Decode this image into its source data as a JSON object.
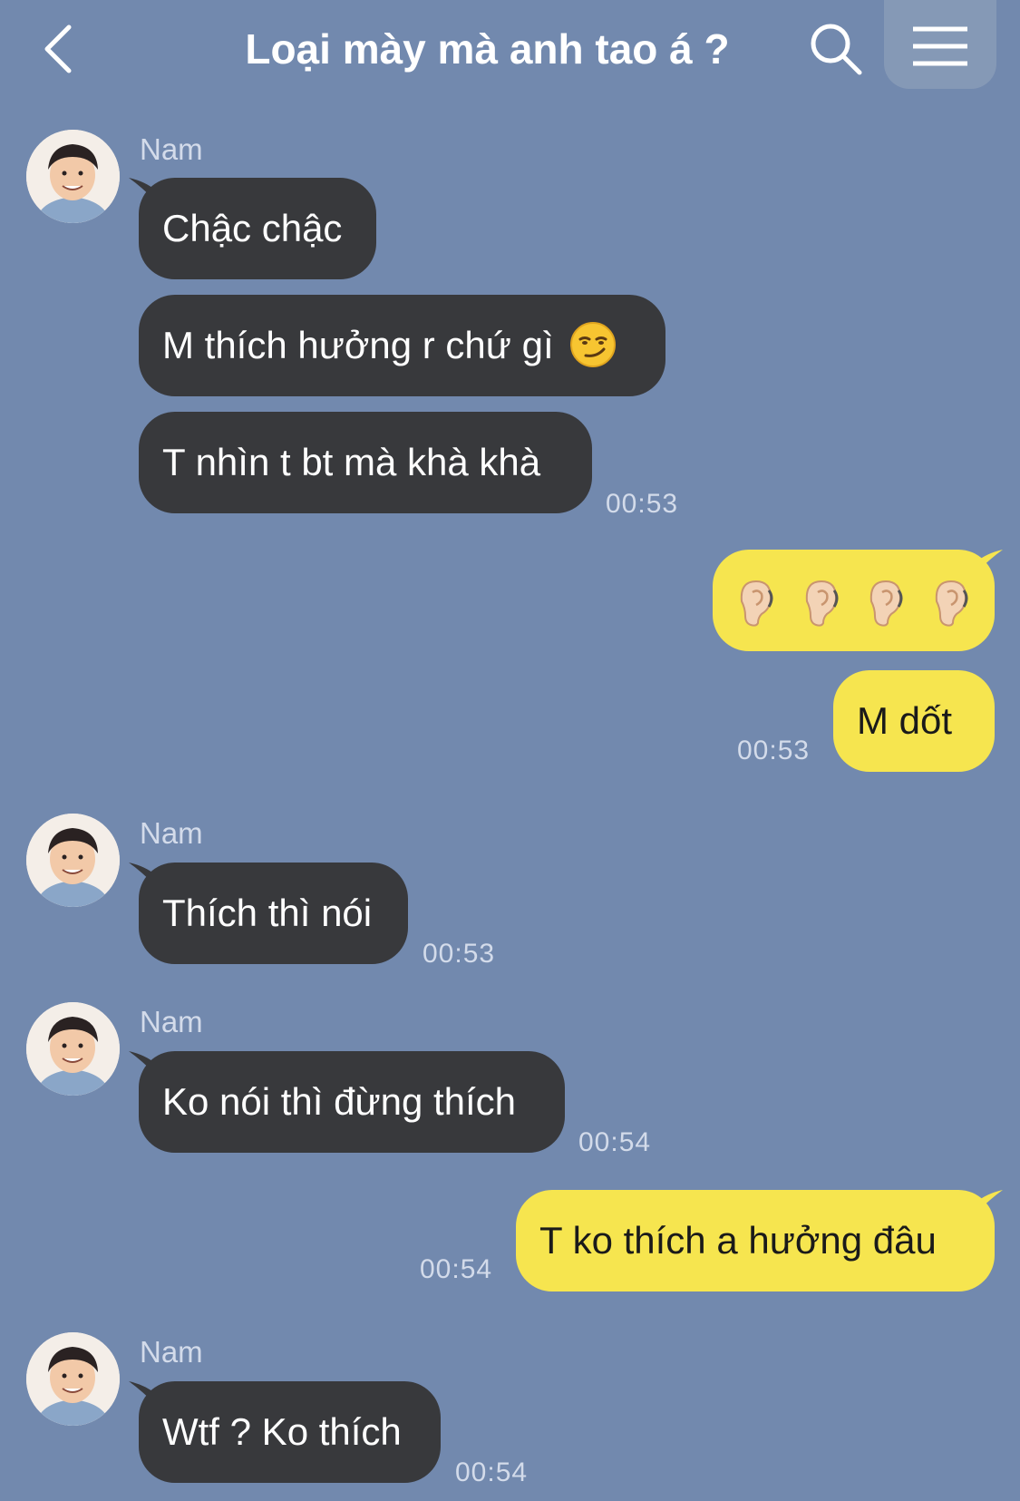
{
  "header": {
    "title": "Loại mày mà anh tao á ?",
    "back_icon": "chevron-left-icon",
    "search_icon": "search-icon",
    "menu_icon": "hamburger-menu-icon"
  },
  "colors": {
    "background": "#7289ae",
    "incoming_bubble": "#38393c",
    "outgoing_bubble": "#f6e54f",
    "timestamp": "#d3dbea"
  },
  "messages": [
    {
      "sender": "Nam",
      "text": "Chậc chậc"
    },
    {
      "text": "M thích hưởng r chứ gì",
      "emoji": "smirking-face-icon"
    },
    {
      "text": "T nhìn t bt mà khà khà",
      "time": "00:53"
    },
    {
      "outgoing": true,
      "emoji": "ear-icon",
      "emoji_count": 4
    },
    {
      "outgoing": true,
      "text": "M dốt",
      "time": "00:53"
    },
    {
      "sender": "Nam",
      "text": "Thích thì nói",
      "time": "00:53"
    },
    {
      "sender": "Nam",
      "text": "Ko nói thì đừng thích",
      "time": "00:54"
    },
    {
      "outgoing": true,
      "text": "T ko thích a hưởng đâu",
      "time": "00:54"
    },
    {
      "sender": "Nam",
      "text": "Wtf ? Ko thích",
      "time": "00:54"
    }
  ]
}
